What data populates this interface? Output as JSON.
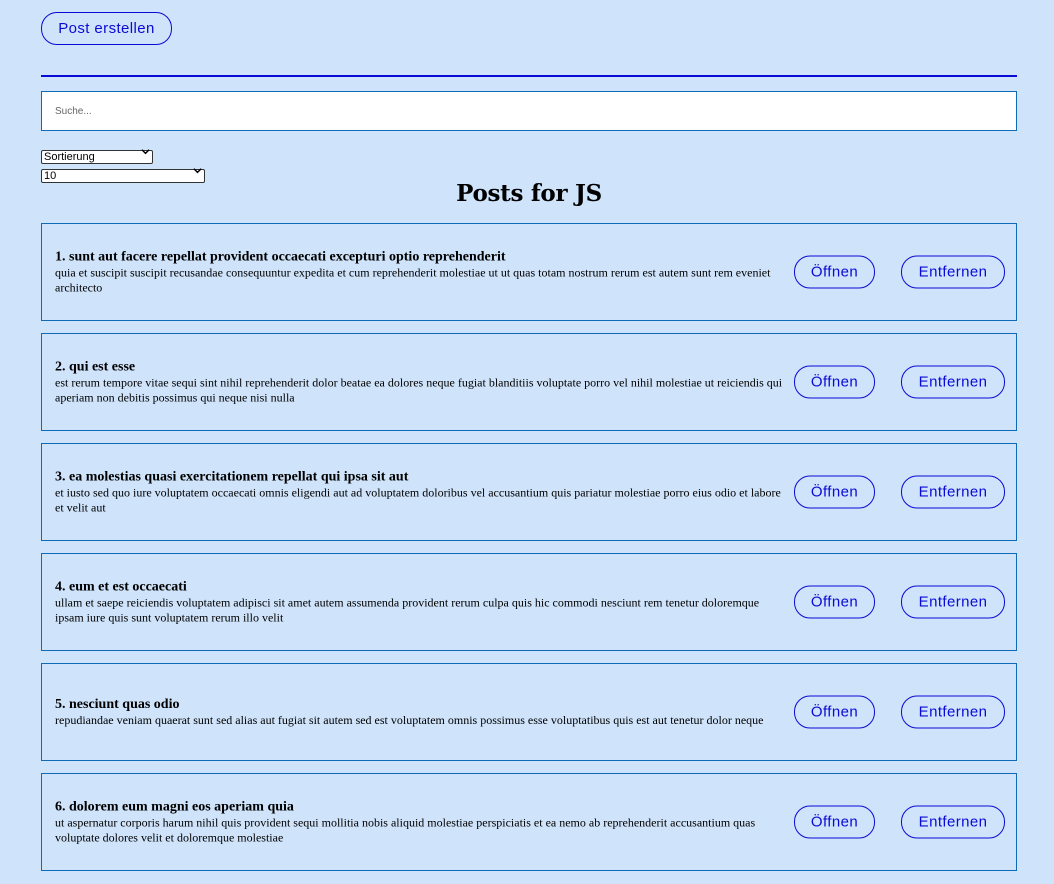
{
  "toolbar": {
    "create_label": "Post erstellen"
  },
  "search": {
    "placeholder": "Suche...",
    "value": ""
  },
  "filters": {
    "sort_selected": "Sortierung",
    "limit_selected": "10"
  },
  "page": {
    "title": "Posts for JS"
  },
  "buttons": {
    "open_label": "Öffnen",
    "remove_label": "Entfernen"
  },
  "colors": {
    "background": "#cfe3fa",
    "accent": "#0a0ad6",
    "border": "#0f6ab8"
  },
  "posts": [
    {
      "title": "1. sunt aut facere repellat provident occaecati excepturi optio reprehenderit",
      "body": "quia et suscipit suscipit recusandae consequuntur expedita et cum reprehenderit molestiae ut ut quas totam nostrum rerum est autem sunt rem eveniet architecto"
    },
    {
      "title": "2. qui est esse",
      "body": "est rerum tempore vitae sequi sint nihil reprehenderit dolor beatae ea dolores neque fugiat blanditiis voluptate porro vel nihil molestiae ut reiciendis qui aperiam non debitis possimus qui neque nisi nulla"
    },
    {
      "title": "3. ea molestias quasi exercitationem repellat qui ipsa sit aut",
      "body": "et iusto sed quo iure voluptatem occaecati omnis eligendi aut ad voluptatem doloribus vel accusantium quis pariatur molestiae porro eius odio et labore et velit aut"
    },
    {
      "title": "4. eum et est occaecati",
      "body": "ullam et saepe reiciendis voluptatem adipisci sit amet autem assumenda provident rerum culpa quis hic commodi nesciunt rem tenetur doloremque ipsam iure quis sunt voluptatem rerum illo velit"
    },
    {
      "title": "5. nesciunt quas odio",
      "body": "repudiandae veniam quaerat sunt sed alias aut fugiat sit autem sed est voluptatem omnis possimus esse voluptatibus quis est aut tenetur dolor neque"
    },
    {
      "title": "6. dolorem eum magni eos aperiam quia",
      "body": "ut aspernatur corporis harum nihil quis provident sequi mollitia nobis aliquid molestiae perspiciatis et ea nemo ab reprehenderit accusantium quas voluptate dolores velit et doloremque molestiae"
    }
  ]
}
